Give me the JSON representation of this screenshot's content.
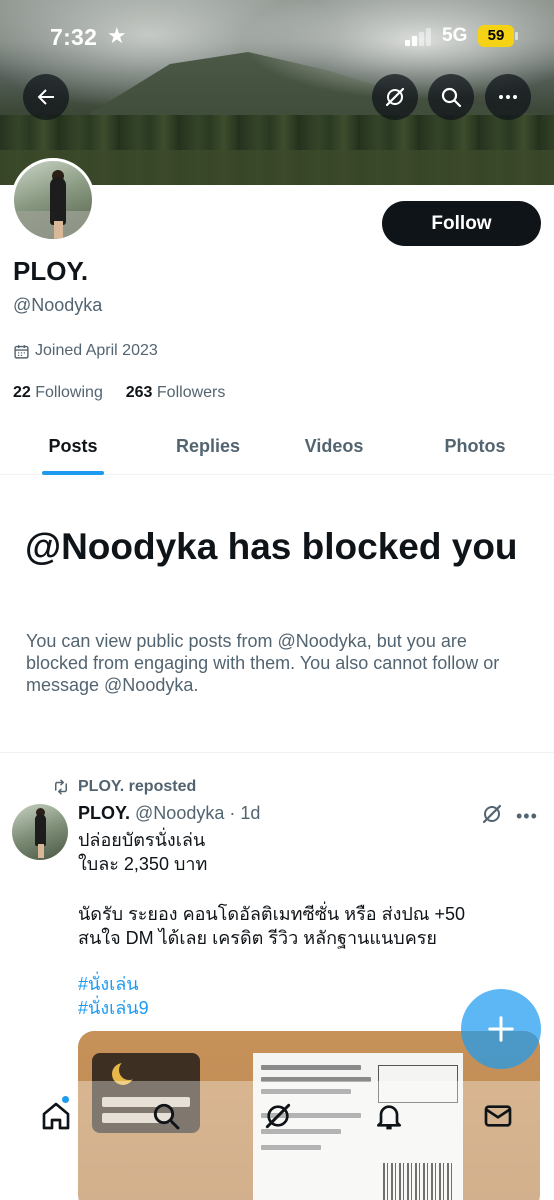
{
  "status_bar": {
    "time": "7:32",
    "time_icon": "★",
    "network": "5G",
    "battery": "59"
  },
  "header": {
    "back_icon": "arrow-left-icon",
    "grok_icon": "grok-icon",
    "search_icon": "search-icon",
    "more_icon": "more-horizontal-icon"
  },
  "profile": {
    "display_name": "PLOY.",
    "handle": "@Noodyka",
    "joined": "Joined April 2023",
    "following_count": "22",
    "following_label": "Following",
    "followers_count": "263",
    "followers_label": "Followers",
    "follow_button": "Follow"
  },
  "tabs": [
    {
      "label": "Posts",
      "active": true
    },
    {
      "label": "Replies",
      "active": false
    },
    {
      "label": "Videos",
      "active": false
    },
    {
      "label": "Photos",
      "active": false
    }
  ],
  "blocked": {
    "title": "@Noodyka has blocked you",
    "text": "You can view public posts from @Noodyka, but you are blocked from engaging with them. You also cannot follow or message @Noodyka."
  },
  "post": {
    "repost_label": "PLOY. reposted",
    "author_name": "PLOY.",
    "author_handle": "@Noodyka",
    "time": "· 1d",
    "more": "•••",
    "lines": [
      "ปล่อยบัตรนั่งเล่น",
      "ใบละ 2,350 บาท",
      "นัดรับ ระยอง คอนโดอัลติเมทซีซั่น หรือ ส่งปณ +50",
      "สนใจ DM ได้เลย เครดิต รีวิว หลักฐานแนบครย"
    ],
    "hashtags": [
      "#นั่งเล่น",
      "#นั่งเล่น9"
    ]
  },
  "fab": {
    "icon": "plus-icon"
  },
  "bottom_nav": {
    "items": [
      "home-icon",
      "search-icon",
      "grok-icon",
      "notifications-icon",
      "messages-icon"
    ]
  },
  "colors": {
    "accent": "#1d9bf0",
    "text_primary": "#0f1419",
    "text_secondary": "#536471",
    "battery": "#f5d213"
  }
}
